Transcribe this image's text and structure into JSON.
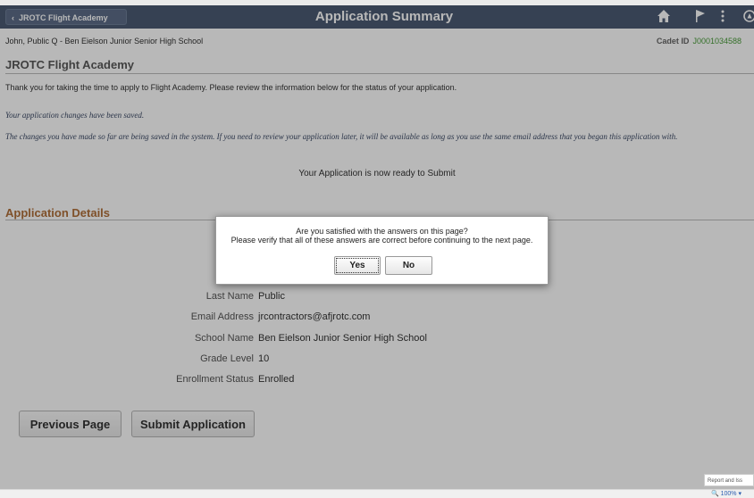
{
  "header": {
    "back_label": "JROTC Flight Academy",
    "title": "Application Summary",
    "icons": [
      "home-icon",
      "flag-icon",
      "more-options-icon",
      "navbar-icon"
    ]
  },
  "subheader": {
    "student": "John, Public Q -  Ben Eielson Junior Senior High School",
    "cadet_label": "Cadet ID",
    "cadet_id": "J0001034588"
  },
  "main": {
    "section_title": "JROTC Flight Academy",
    "intro": "Thank you for taking the time to apply to Flight Academy. Please review the information below for the status of your application.",
    "saved_msg": "Your application changes have been saved.",
    "changes_msg": "The changes you have made so far are being saved in the system. If you need to review your application later, it will be available as long as you use the same email address that you began this application with.",
    "ready_msg": "Your Application is now ready to Submit",
    "details_title": "Application Details",
    "partial_label": "Fi",
    "fields": [
      {
        "label": "Last Name",
        "value": "Public"
      },
      {
        "label": "Email Address",
        "value": "jrcontractors@afjrotc.com"
      },
      {
        "label": "School Name",
        "value": "Ben Eielson Junior Senior High School"
      },
      {
        "label": "Grade Level",
        "value": "10"
      },
      {
        "label": "Enrollment Status",
        "value": "Enrolled"
      }
    ]
  },
  "buttons": {
    "previous": "Previous Page",
    "submit": "Submit Application"
  },
  "dialog": {
    "line1": "Are you satisfied with the answers on this page?",
    "line2": "Please verify that all of these answers are correct before continuing to the next page.",
    "yes": "Yes",
    "no": "No"
  },
  "footer": {
    "report": "Report and Iss",
    "zoom": "100%"
  },
  "colors": {
    "header_bg": "#4b5a74",
    "section_title": "#595959",
    "details_title": "#b0703a",
    "cadet_id": "#4a9c3b"
  }
}
